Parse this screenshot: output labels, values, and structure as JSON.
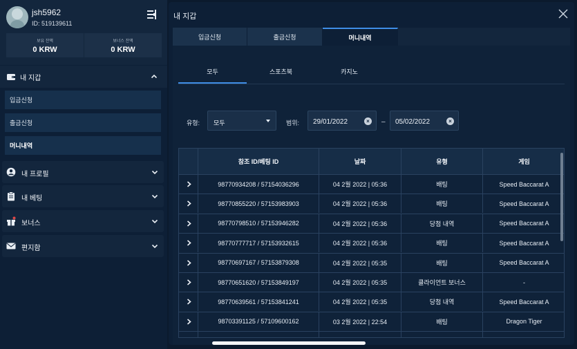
{
  "profile": {
    "username": "jsh5962",
    "user_id": "ID: 519139611",
    "balance_label": "보유 잔액",
    "balance_value": "0 KRW",
    "bonus_label": "보너스 잔액",
    "bonus_value": "0 KRW"
  },
  "sidebar": {
    "wallet": {
      "label": "내 지갑",
      "items": [
        {
          "label": "입금신청"
        },
        {
          "label": "출금신청"
        },
        {
          "label": "머니내역"
        }
      ]
    },
    "sections": [
      {
        "label": "내 프로필",
        "icon": "user-icon"
      },
      {
        "label": "내 베팅",
        "icon": "clipboard-icon"
      },
      {
        "label": "보너스",
        "icon": "gift-icon"
      },
      {
        "label": "편지함",
        "icon": "envelope-icon"
      }
    ]
  },
  "main": {
    "title": "내 지갑",
    "tabs": [
      {
        "label": "입금신청"
      },
      {
        "label": "출금신청"
      },
      {
        "label": "머니내역",
        "active": true
      }
    ],
    "subtabs": [
      {
        "label": "모두",
        "active": true
      },
      {
        "label": "스포츠북"
      },
      {
        "label": "카지노"
      }
    ],
    "filters": {
      "type_label": "유형:",
      "type_value": "모두",
      "range_label": "범위:",
      "date_from": "29/01/2022",
      "date_sep": "–",
      "date_to": "05/02/2022"
    },
    "table": {
      "headers": [
        "참조 ID/베팅 ID",
        "날짜",
        "유형",
        "게임"
      ],
      "rows": [
        {
          "ref": "98770934208 / 57154036296",
          "date": "04 2월 2022 | 05:36",
          "type": "배팅",
          "game": "Speed Baccarat A"
        },
        {
          "ref": "98770855220 / 57153983903",
          "date": "04 2월 2022 | 05:36",
          "type": "배팅",
          "game": "Speed Baccarat A"
        },
        {
          "ref": "98770798510 / 57153946282",
          "date": "04 2월 2022 | 05:36",
          "type": "당첨 내역",
          "game": "Speed Baccarat A"
        },
        {
          "ref": "98770777717 / 57153932615",
          "date": "04 2월 2022 | 05:36",
          "type": "배팅",
          "game": "Speed Baccarat A"
        },
        {
          "ref": "98770697167 / 57153879308",
          "date": "04 2월 2022 | 05:35",
          "type": "배팅",
          "game": "Speed Baccarat A"
        },
        {
          "ref": "98770651620 / 57153849197",
          "date": "04 2월 2022 | 05:35",
          "type": "클라이언트 보너스",
          "game": "-"
        },
        {
          "ref": "98770639561 / 57153841241",
          "date": "04 2월 2022 | 05:35",
          "type": "당첨 내역",
          "game": "Speed Baccarat A"
        },
        {
          "ref": "98703391125 / 57109600162",
          "date": "03 2월 2022 | 22:54",
          "type": "배팅",
          "game": "Dragon Tiger"
        }
      ]
    }
  },
  "colors": {
    "accent": "#3f8ee6",
    "background": "#0b1a2d",
    "panel": "#0d1f36"
  }
}
